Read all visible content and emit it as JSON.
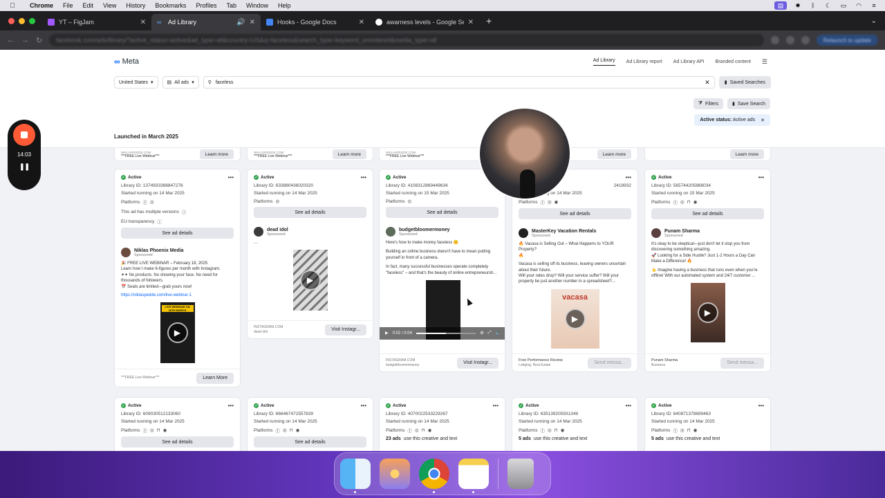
{
  "menubar": {
    "app_name": "Chrome",
    "items": [
      "File",
      "Edit",
      "View",
      "History",
      "Bookmarks",
      "Profiles",
      "Tab",
      "Window",
      "Help"
    ]
  },
  "tabs": [
    {
      "title": "YT – FigJam",
      "color": "#a259ff"
    },
    {
      "title": "Ad Library",
      "color": "#0866ff"
    },
    {
      "title": "Hooks - Google Docs",
      "color": "#4285f4"
    },
    {
      "title": "awarness levels - Google Se...",
      "color": "#ffffff"
    }
  ],
  "toolbar": {
    "url": "facebook.com/ads/library/?active_status=active&ad_type=all&country=US&q=faceless&search_type=keyword_unordered&media_type=all",
    "relaunch": "Relaunch to update"
  },
  "meta": {
    "logo": "Meta",
    "nav": [
      "Ad Library",
      "Ad Library report",
      "Ad Library API",
      "Branded content"
    ],
    "country": "United States",
    "ad_type": "All ads",
    "search_value": "faceless",
    "saved_searches": "Saved Searches",
    "filters": "Filters",
    "save_search": "Save Search",
    "status_label": "Active status:",
    "status_value": "Active ads",
    "launched": "Launched in March 2025"
  },
  "stubs": [
    {
      "domain": "NIKLASPEDDE.COM",
      "text": "***FREE Live Webinar***",
      "cta": "Learn more"
    },
    {
      "domain": "NIKLASPEDDE.COM",
      "text": "***FREE Live Webinar***",
      "cta": "Learn more"
    },
    {
      "domain": "NIKLASPEDDE.COM",
      "text": "***FREE Live Webinar***",
      "cta": "Le"
    },
    {
      "domain": "",
      "text": "",
      "cta": "Learn more"
    },
    {
      "domain": "",
      "text": "",
      "cta": "Learn more"
    }
  ],
  "common": {
    "active": "Active",
    "see_details": "See ad details",
    "platforms": "Platforms",
    "sponsored": "Sponsored"
  },
  "cards": [
    {
      "library_id": "Library ID: 1374933386847276",
      "started": "Started running on 14 Mar 2025",
      "versions": "This ad has multiple versions",
      "eu": "EU transparency",
      "advertiser": "Niklas Phoenix Media",
      "text_lines": [
        "🎉 FREE LIVE WEBINAR – February 18, 2025",
        "Learn how I make 6-figures per month with Instagram.",
        "✦✦ No products. No showing your face. No need for",
        "thousands of followers.",
        "📅 Seats are limited—grab yours now!"
      ],
      "link": "https://niklaspedde.com/live-webinar-1",
      "media_label": "LIVE WEBINAR ON 18TH MARCH",
      "footer_text": "***FREE Live Webinar***",
      "cta": "Learn More"
    },
    {
      "library_id": "Library ID: 633880436020320",
      "started": "Started running on 14 Mar 2025",
      "advertiser": "dead idol",
      "footer_domain": "INSTAGRAM.COM",
      "footer_text": "dead idol",
      "cta": "Visit Instagr..."
    },
    {
      "library_id": "Library ID: 4108312869449634",
      "started": "Started running on 15 Mar 2025",
      "advertiser": "budgetbloomermoney",
      "text_lines": [
        "Here's how to make money faceless 🤫",
        "",
        "Building an online business doesn't have to mean putting",
        "yourself in front of a camera.",
        "",
        "In fact, many successful businesses operate completely",
        "\"faceless\" – and that's the beauty of online entrepreneursh..."
      ],
      "video_time": "0:02 / 0:04",
      "footer_domain": "INSTAGRAM.COM",
      "footer_text": "budgetbloomermoney",
      "cta": "Visit Instagr..."
    },
    {
      "library_id": "2418932",
      "started": "Started running on 14 Mar 2025",
      "advertiser": "MasterKey Vacation Rentals",
      "text_lines": [
        "🔥 Vacasa is Selling Out – What Happens to YOUR Property?",
        "🔥",
        "",
        "Vacasa is selling off its business, leaving owners uncertain",
        "about their future.",
        "Will your rates drop? Will your service suffer? Will your",
        "property be just another number in a spreadsheet?..."
      ],
      "media_label": "vacasa",
      "footer_domain": "Free Performance Review",
      "footer_text": "Lodging, Real Estate",
      "cta": "Send messa..."
    },
    {
      "library_id": "Library ID: 565744205888034",
      "started": "Started running on 15 Mar 2025",
      "advertiser": "Punam Sharma",
      "text_lines": [
        "It's okay to be skeptical—just don't let it stop you from",
        "discovering something amazing.",
        "🚀 Looking for a Side Hustle? Just 1-2 Hours a Day Can",
        "Make a Difference! 🔥",
        "",
        "👆 Imagine having a business that runs even when you're",
        "offline! With our automated system and 24/7 customer ..."
      ],
      "footer_domain": "Punam Sharma",
      "footer_text": "Business",
      "cta": "Send messa..."
    }
  ],
  "row2": [
    {
      "library_id": "Library ID: 609030512133060",
      "started": "Started running on 14 Mar 2025",
      "extra": "",
      "extra_bold": ""
    },
    {
      "library_id": "Library ID: 666467472557839",
      "started": "Started running on 14 Mar 2025",
      "extra": "",
      "extra_bold": ""
    },
    {
      "library_id": "Library ID: 4070022533229267",
      "started": "Started running on 14 Mar 2025",
      "extra": "use this creative and text",
      "extra_bold": "23 ads"
    },
    {
      "library_id": "Library ID: 635139205931349",
      "started": "Started running on 14 Mar 2025",
      "extra": "use this creative and text",
      "extra_bold": "5 ads"
    },
    {
      "library_id": "Library ID: 640871378699463",
      "started": "Started running on 14 Mar 2025",
      "extra": "use this creative and text",
      "extra_bold": "5 ads"
    }
  ],
  "recorder": {
    "time": "14:03"
  }
}
